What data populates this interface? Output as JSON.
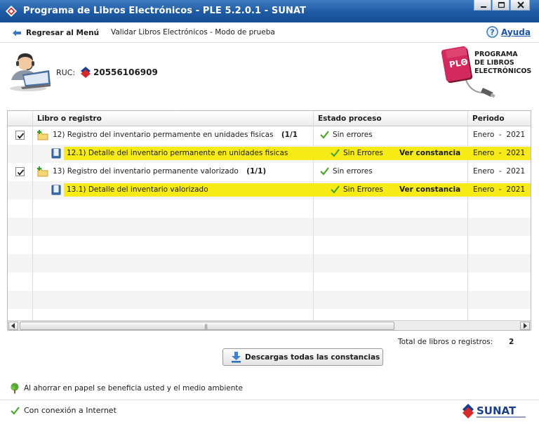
{
  "window": {
    "title": "Programa de Libros Electrónicos - PLE 5.2.0.1 - SUNAT",
    "controls": [
      "minimize-icon",
      "maximize-icon",
      "close-icon"
    ]
  },
  "nav": {
    "back_label": "Regresar al Menú",
    "breadcrumb": "Validar Libros Electrónicos  - Modo de prueba",
    "help_label": "Ayuda"
  },
  "header": {
    "ruc_label": "RUC:",
    "ruc_value": "20556106909",
    "ple_badge_text": "PLΘ",
    "ple_title": [
      "PROGRAMA",
      "DE LIBROS",
      "ELECTRÓNICOS"
    ]
  },
  "table": {
    "columns": [
      "Libro o registro",
      "Estado proceso",
      "Periodo"
    ],
    "rows": [
      {
        "text": "12) Registro del inventario permamente en unidades fisicas",
        "count": "(1/1",
        "checked": true,
        "estado": "Sin errores",
        "link": "",
        "periodo": "Enero  -  2021",
        "highlight": false,
        "child": false
      },
      {
        "text": "12.1) Detalle del inventario permanente en unidades fisicas",
        "count": "",
        "checked": false,
        "estado": "Sin Errores",
        "link": "Ver constancia",
        "periodo": "Enero  -  2021",
        "highlight": true,
        "child": true
      },
      {
        "text": "13) Registro del inventario permanente valorizado",
        "count": "(1/1)",
        "checked": true,
        "estado": "Sin errores",
        "link": "",
        "periodo": "Enero  -  2021",
        "highlight": false,
        "child": false
      },
      {
        "text": "13.1) Detalle del inventario valorizado",
        "count": "",
        "checked": false,
        "estado": "Sin Errores",
        "link": "Ver constancia",
        "periodo": "Enero  -  2021",
        "highlight": true,
        "child": true
      }
    ],
    "highlight_color": "#f6ea17"
  },
  "summary": {
    "total_label": "Total de libros o registros:",
    "total_value": "2"
  },
  "actions": {
    "download_label": "Descargas todas las constancias"
  },
  "footer": {
    "eco_message": "Al ahorrar en papel se beneficia usted y el medio ambiente",
    "connection_status": "Con conexión a Internet",
    "brand": "SUNAT"
  },
  "colors": {
    "titlebar": "#1d5aa3",
    "link": "#1a52a8",
    "check": "#4aa62a"
  }
}
